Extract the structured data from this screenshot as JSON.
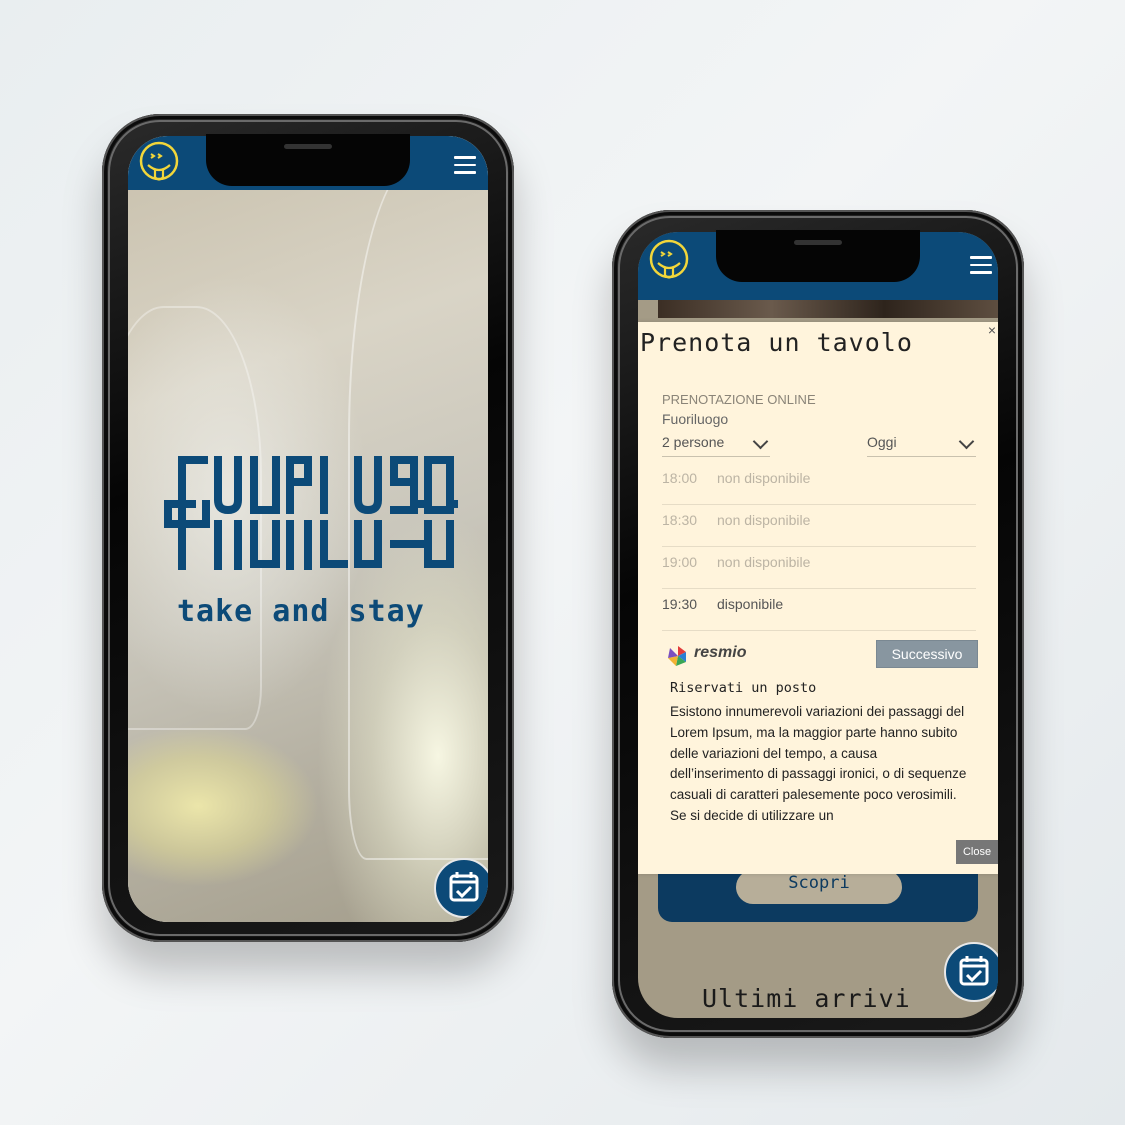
{
  "colors": {
    "brand_blue": "#0c4a78",
    "logo_yellow": "#f2d63a",
    "modal_bg": "#fff4dc",
    "next_button": "#8896a0"
  },
  "phone_home": {
    "header": {
      "logo_icon": "smiley-tongue-icon",
      "menu_icon": "hamburger-menu-icon"
    },
    "brand_logo_text": "fuoriluogo",
    "tagline": "take and stay",
    "booking_fab_icon": "calendar-check-icon"
  },
  "phone_booking": {
    "header": {
      "logo_icon": "smiley-tongue-icon",
      "menu_icon": "hamburger-menu-icon"
    },
    "modal": {
      "close_x": "×",
      "title": "Prenota un tavolo",
      "kicker": "PRENOTAZIONE ONLINE",
      "venue": "Fuoriluogo",
      "guests_select": "2 persone",
      "date_select": "Oggi",
      "slots": [
        {
          "time": "18:00",
          "status": "non disponibile"
        },
        {
          "time": "18:30",
          "status": "non disponibile"
        },
        {
          "time": "19:00",
          "status": "non disponibile"
        },
        {
          "time": "19:30",
          "status": "disponibile"
        }
      ],
      "provider": "resmio",
      "next_button": "Successivo",
      "subtitle": "Riservati un posto",
      "body": "Esistono innumerevoli variazioni dei passaggi del Lorem Ipsum, ma la maggior parte hanno subito delle variazioni del tempo, a causa dell’inserimento di passaggi ironici, o di sequenze casuali di caratteri palesemente poco verosimili. Se si decide di utilizzare un",
      "close_button": "Close"
    },
    "background": {
      "discover_button": "Scopri",
      "section_title": "Ultimi arrivi"
    },
    "booking_fab_icon": "calendar-check-icon"
  }
}
